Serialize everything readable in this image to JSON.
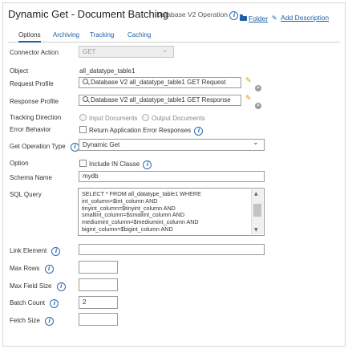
{
  "header": {
    "title": "Dynamic Get - Document Batching",
    "subtitle": "- Database V2 Operation",
    "folder_link": "Folder",
    "add_description_link": "Add Description"
  },
  "tabs": [
    {
      "label": "Options",
      "active": true
    },
    {
      "label": "Archiving",
      "active": false
    },
    {
      "label": "Tracking",
      "active": false
    },
    {
      "label": "Caching",
      "active": false
    }
  ],
  "form": {
    "connector_action": {
      "label": "Connector Action",
      "value": "GET"
    },
    "object": {
      "label": "Object",
      "value": "all_datatype_table1"
    },
    "request_profile": {
      "label": "Request Profile",
      "value": "Database V2 all_datatype_table1 GET Request"
    },
    "response_profile": {
      "label": "Response Profile",
      "value": "Database V2 all_datatype_table1 GET Response"
    },
    "tracking_direction": {
      "label": "Tracking Direction",
      "options": [
        "Input Documents",
        "Output Documents"
      ]
    },
    "error_behavior": {
      "label": "Error Behavior",
      "checkbox_label": "Return Application Error Responses",
      "checked": false
    },
    "get_operation_type": {
      "label": "Get Operation Type",
      "value": "Dynamic Get"
    },
    "option": {
      "label": "Option",
      "checkbox_label": "Include IN Clause",
      "checked": false
    },
    "schema_name": {
      "label": "Schema Name",
      "value": "mydb"
    },
    "sql_query": {
      "label": "SQL Query",
      "value": "SELECT * FROM all_datatype_table1 WHERE\nint_column=$int_column AND\ntinyint_column=$tinyint_column AND\nsmallint_column=$smallint_column AND\nmediumint_column=$mediumint_column AND\nbigint_column=$bigint_column AND"
    },
    "link_element": {
      "label": "Link Element",
      "value": ""
    },
    "max_rows": {
      "label": "Max Rows",
      "value": ""
    },
    "max_field_size": {
      "label": "Max Field Size",
      "value": ""
    },
    "batch_count": {
      "label": "Batch Count",
      "value": "2"
    },
    "fetch_size": {
      "label": "Fetch Size",
      "value": ""
    }
  },
  "icons": {
    "info": "info-circle-icon",
    "folder": "folder-icon",
    "edit": "pencil-icon",
    "clear": "clear-x-icon",
    "search": "search-icon",
    "dropdown": "chevron-down-icon"
  },
  "colors": {
    "link": "#1f5fa8",
    "pencil": "#d49a00",
    "border": "#9a9a9a"
  }
}
